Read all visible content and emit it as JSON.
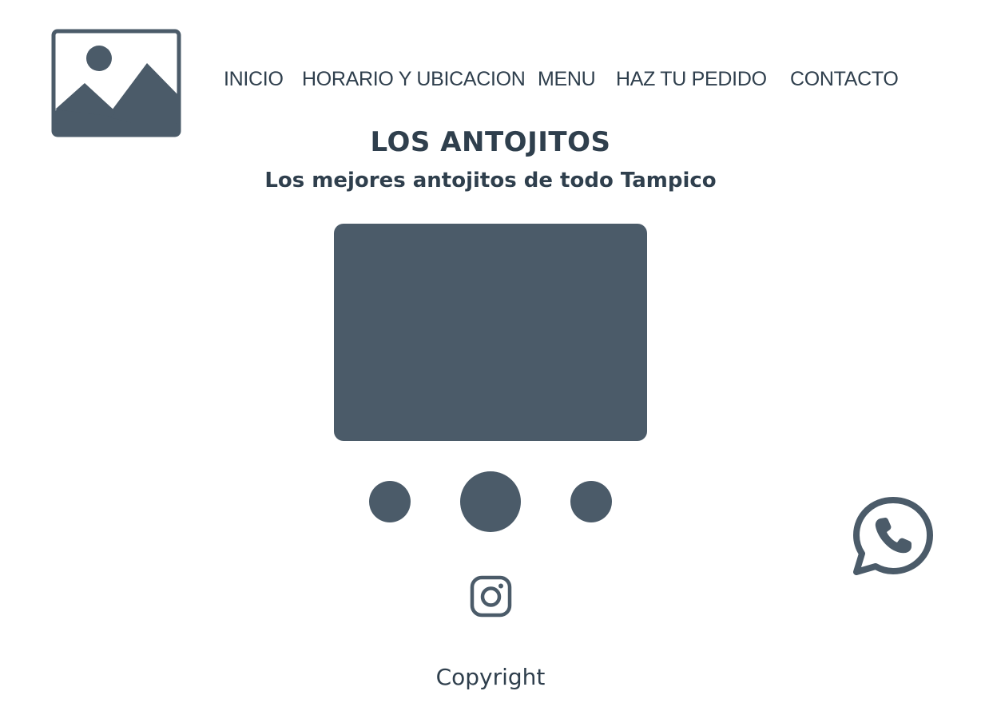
{
  "header": {
    "logo_icon": "image-placeholder-icon",
    "nav": [
      {
        "label": "INICIO"
      },
      {
        "label": "HORARIO Y UBICACION"
      },
      {
        "label": "MENU"
      },
      {
        "label": "HAZ TU PEDIDO"
      },
      {
        "label": "CONTACTO"
      }
    ]
  },
  "hero": {
    "title": "LOS ANTOJITOS",
    "subtitle": "Los mejores antojitos de todo Tampico",
    "carousel_dots": 3,
    "active_dot": 2
  },
  "social": {
    "instagram_icon": "instagram-icon",
    "whatsapp_icon": "whatsapp-icon"
  },
  "footer": {
    "copyright": "Copyright"
  },
  "colors": {
    "primary": "#4b5b69",
    "text": "#2f3f4d",
    "background": "#ffffff"
  }
}
